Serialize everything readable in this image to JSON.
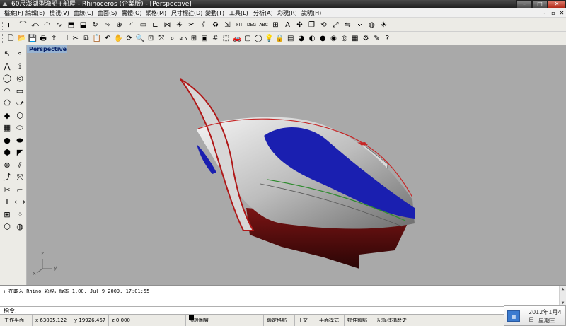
{
  "window": {
    "title": "60尺澎湖型漁船+船屋 - Rhinoceros (企業版) - [Perspective]",
    "minimize": "–",
    "maximize": "□",
    "close": "✕"
  },
  "menu": {
    "items": [
      "檔案(F)",
      "編輯(E)",
      "檢視(V)",
      "曲線(C)",
      "曲面(S)",
      "實體(O)",
      "網格(M)",
      "尺寸標註(D)",
      "變動(T)",
      "工具(L)",
      "分析(A)",
      "彩現(R)",
      "說明(H)"
    ],
    "mdi_min": "-",
    "mdi_restore": "▫",
    "mdi_close": "✕"
  },
  "toolbar1": {
    "icons": [
      "line-icon",
      "polyline-icon",
      "curve-icon",
      "arc-icon",
      "spline-icon",
      "extrude-icon",
      "loft-icon",
      "revolve-icon",
      "sweep-icon",
      "boolean-icon",
      "fillet-icon",
      "shell-icon",
      "offset-icon",
      "join-icon",
      "explode-icon",
      "trim-icon",
      "split-icon",
      "rebuild-icon",
      "project-icon",
      "points-icon",
      "mesh-icon",
      "dims-icon",
      "nurbs-icon",
      "text-icon",
      "move-icon",
      "copy-icon",
      "rotate-icon",
      "scale-icon",
      "mirror-icon",
      "array-icon",
      "analyze-icon",
      "render-icon"
    ],
    "glyphs": [
      "⟝",
      "⌒",
      "⤺",
      "◠",
      "∿",
      "⬒",
      "⬓",
      "↻",
      "⤳",
      "⊕",
      "◜",
      "▭",
      "⊏",
      "⋈",
      "✳",
      "✂",
      "⫽",
      "♻",
      "⇲",
      "FIT",
      "DEG",
      "ABC",
      "⊞",
      "A",
      "✣",
      "❐",
      "⟲",
      "⤢",
      "⇋",
      "⁘",
      "◍",
      "☀"
    ]
  },
  "toolbar2": {
    "icons": [
      "new-icon",
      "open-icon",
      "save-icon",
      "print-icon",
      "import-icon",
      "copy-doc-icon",
      "cut-icon",
      "copy-icon",
      "paste-icon",
      "undo-icon",
      "pan-icon",
      "rotate-view-icon",
      "zoom-icon",
      "zoom-window-icon",
      "zoom-extents-icon",
      "zoom-selected-icon",
      "zoom-previous-icon",
      "four-view-icon",
      "viewport-icon",
      "grid-icon",
      "select-icon",
      "car-icon",
      "box-icon",
      "circle-icon",
      "light-icon",
      "lock-icon",
      "layer-icon",
      "color-icon",
      "shade-icon",
      "render-sphere-icon",
      "material-icon",
      "environment-icon",
      "texture-icon",
      "settings-icon",
      "options-icon",
      "help-icon"
    ],
    "glyphs": [
      "🗋",
      "📂",
      "💾",
      "🖶",
      "⇪",
      "❐",
      "✂",
      "⧉",
      "📋",
      "↶",
      "✋",
      "⟳",
      "🔍",
      "⊡",
      "⤧",
      "⌕",
      "⤺",
      "⊞",
      "▣",
      "#",
      "⬚",
      "🚗",
      "▢",
      "◯",
      "💡",
      "🔒",
      "▤",
      "◕",
      "◐",
      "●",
      "◉",
      "◎",
      "▦",
      "⚙",
      "✎",
      "?"
    ]
  },
  "lefttools": {
    "icons": [
      "select-arrow-icon",
      "point-icon",
      "polyline-icon",
      "curve-points-icon",
      "circle-icon",
      "ellipse-icon",
      "arc-icon",
      "rectangle-icon",
      "polygon-icon",
      "free-curve-icon",
      "surface-icon",
      "extrude-surface-icon",
      "box-solid-icon",
      "cylinder-solid-icon",
      "sphere-solid-icon",
      "pipe-icon",
      "mesh-icon",
      "fillet-edge-icon",
      "boolean-union-icon",
      "boolean-split-icon",
      "move-icon",
      "scale-icon",
      "trim-icon",
      "split-icon",
      "text-icon",
      "dimension-icon",
      "group-icon",
      "array-icon",
      "block-icon",
      "analyze-icon"
    ],
    "glyphs": [
      "↖",
      "∘",
      "⋀",
      "⟟",
      "◯",
      "◎",
      "◠",
      "▭",
      "⬠",
      "⤻",
      "◆",
      "⬡",
      "▦",
      "⬭",
      "●",
      "⬬",
      "⬢",
      "◤",
      "⊕",
      "⫽",
      "⤴",
      "⤧",
      "✂",
      "⌐",
      "T",
      "⟷",
      "⊞",
      "⁘",
      "⬡",
      "◍"
    ]
  },
  "viewport": {
    "label": "Perspective",
    "axis_x": "x",
    "axis_y": "y",
    "axis_z": "z"
  },
  "command": {
    "history": "正在載入 Rhino 彩現，版本 1.00, Jul  9 2009, 17:01:55",
    "prompt": "指令:",
    "scroll_up": "▲",
    "scroll_down": "▼"
  },
  "status": {
    "cplane": "工作平面",
    "x": "x 63095.122",
    "y": "y 19926.467",
    "z": "z 0.000",
    "layer": "預設圖層",
    "snap": "鎖定格點",
    "ortho": "正交",
    "planar": "平面模式",
    "osnap": "物件鎖點",
    "history": "記錄建構歷史"
  },
  "clock": {
    "date": "2012年1月4日",
    "weekday": "星期三",
    "cal_glyph": "▦"
  },
  "colors": {
    "titlebar": "#2a2a2a",
    "viewport_bg": "#a9a9a9",
    "hull_blue": "#1a1fb0",
    "hull_red": "#8a1515",
    "tab": "#99b4d1"
  }
}
